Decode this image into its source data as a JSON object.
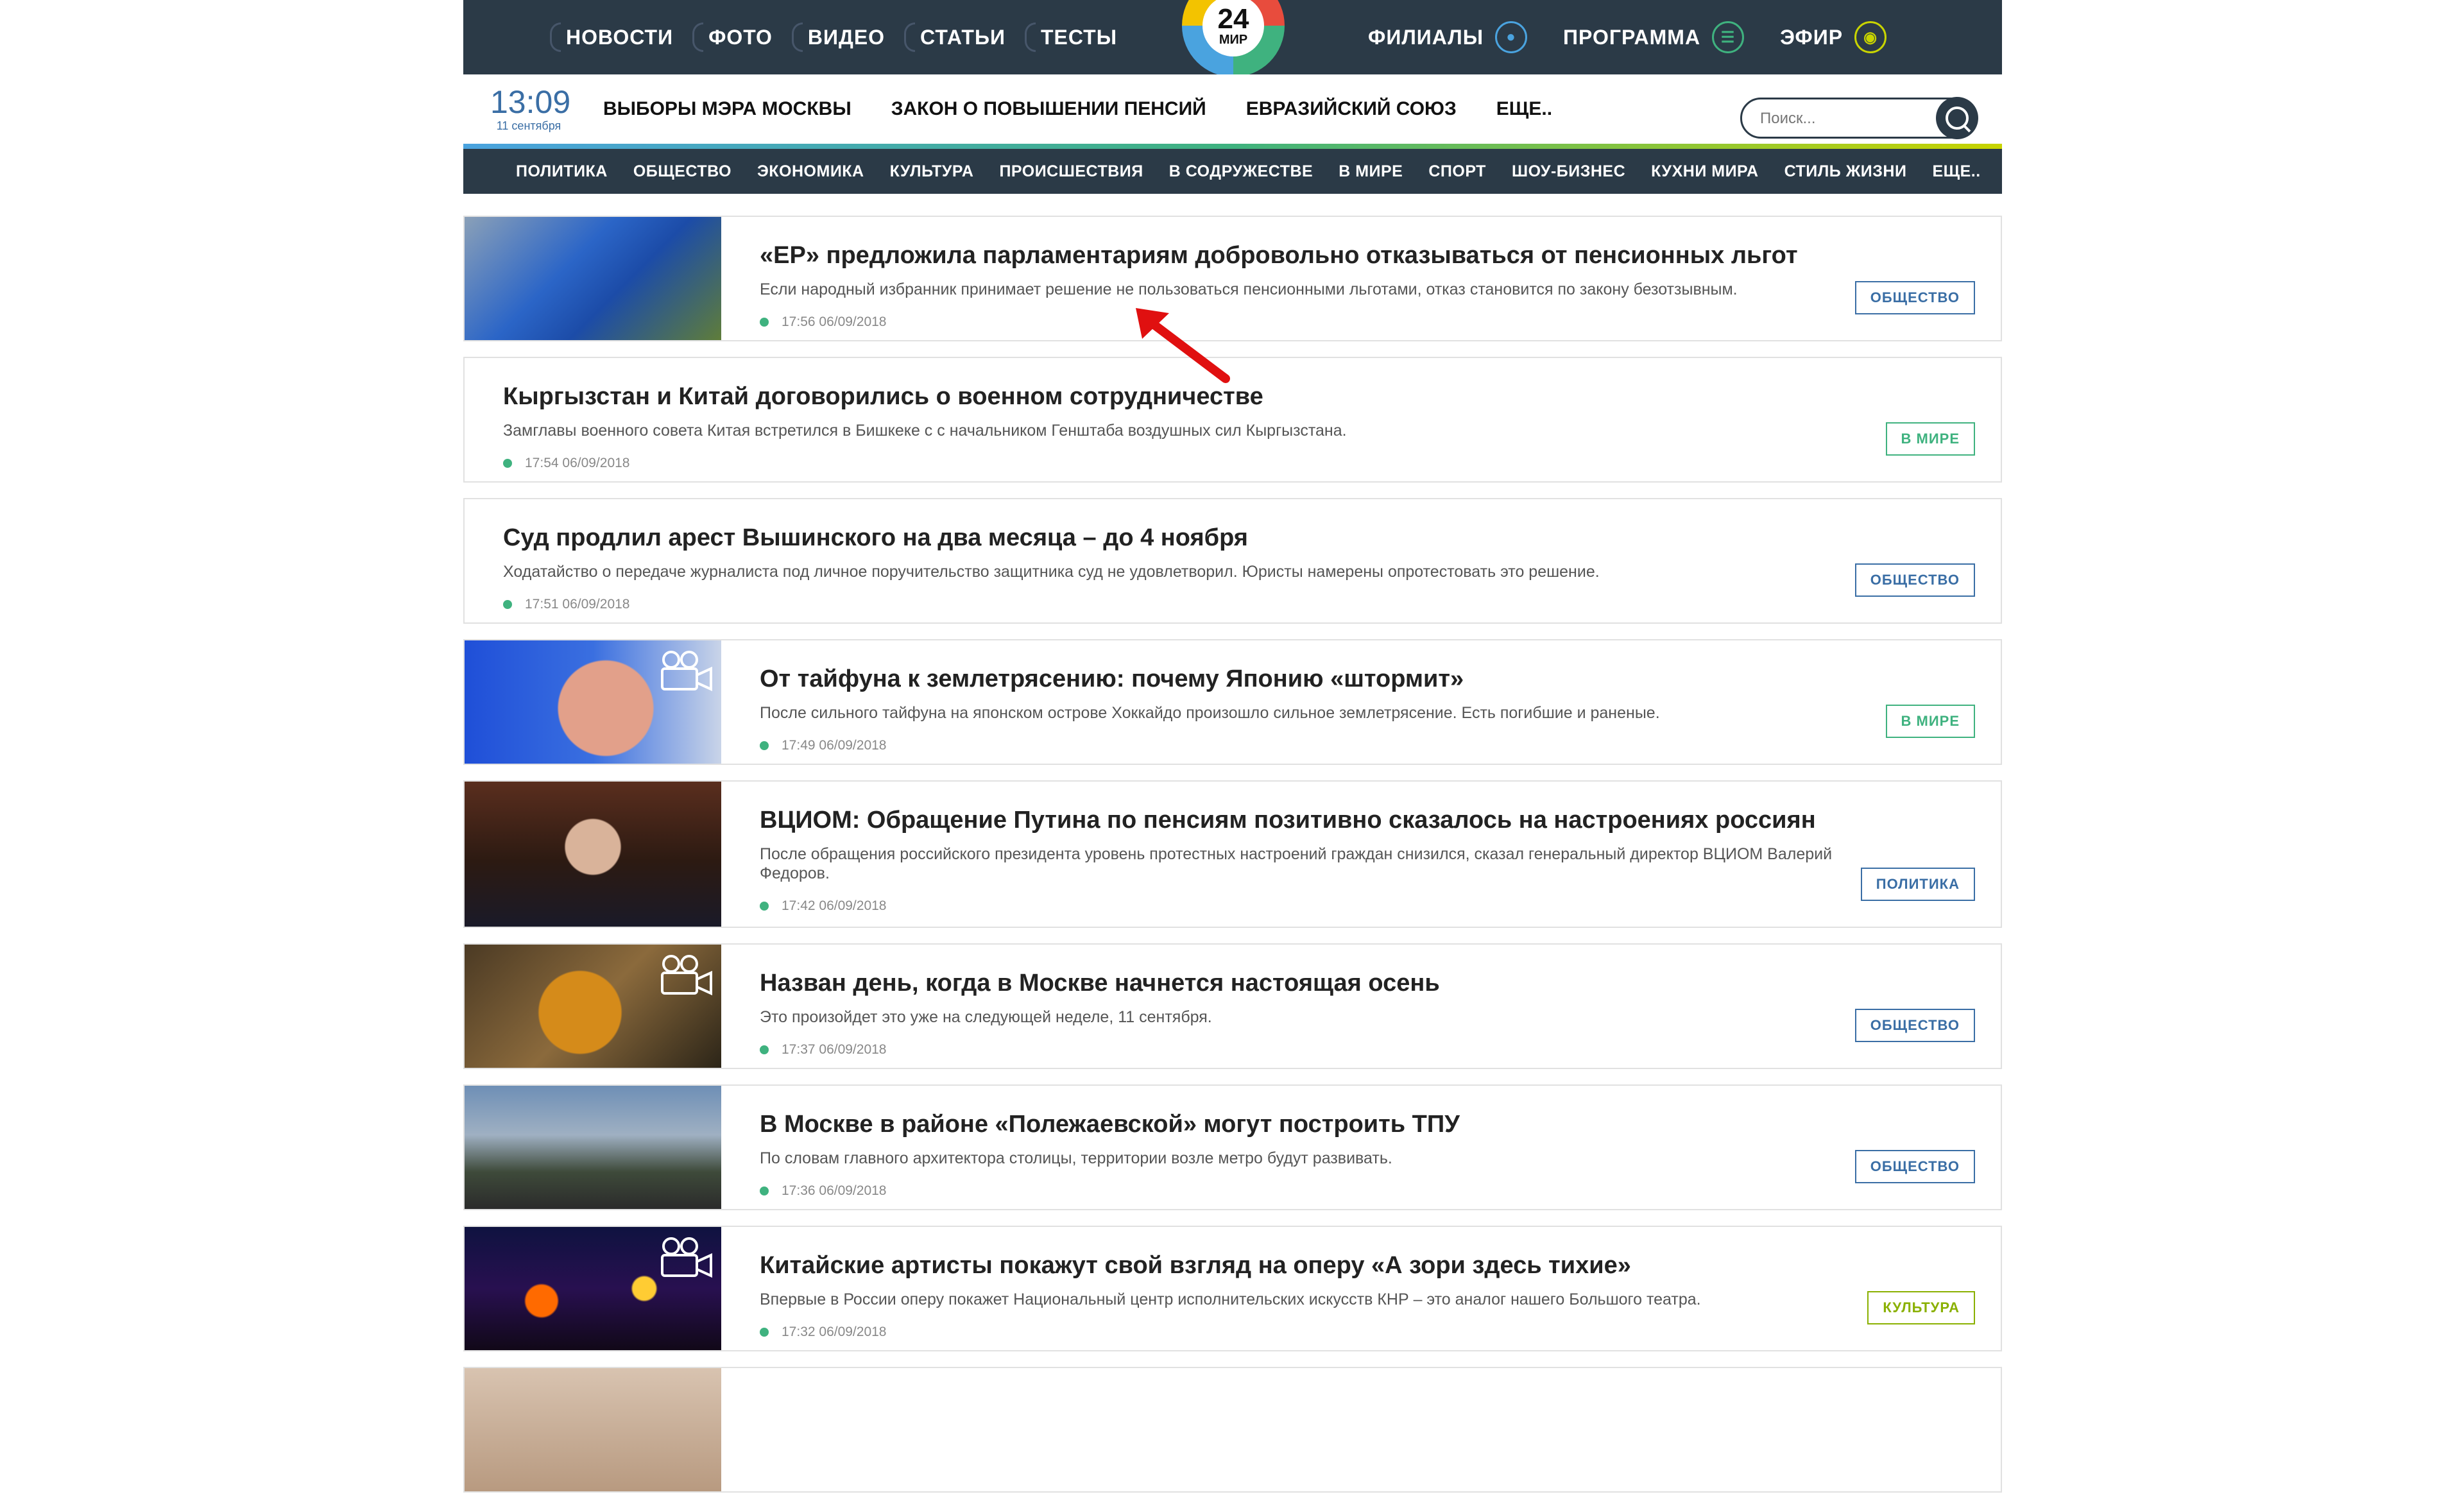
{
  "topnav": {
    "left": [
      "НОВОСТИ",
      "ФОТО",
      "ВИДЕО",
      "СТАТЬИ",
      "ТЕСТЫ"
    ],
    "logo_number": "24",
    "logo_word": "МИР",
    "right": [
      {
        "label": "ФИЛИАЛЫ",
        "icon": "location-pin-icon"
      },
      {
        "label": "ПРОГРАММА",
        "icon": "schedule-icon"
      },
      {
        "label": "ЭФИР",
        "icon": "live-broadcast-icon"
      }
    ]
  },
  "clock": {
    "time": "13:09",
    "date": "11 сентября"
  },
  "hot_links": [
    "ВЫБОРЫ МЭРА МОСКВЫ",
    "ЗАКОН О ПОВЫШЕНИИ ПЕНСИЙ",
    "ЕВРАЗИЙСКИЙ СОЮЗ",
    "ЕЩЕ.."
  ],
  "search": {
    "placeholder": "Поиск..."
  },
  "categories": [
    "ПОЛИТИКА",
    "ОБЩЕСТВО",
    "ЭКОНОМИКА",
    "КУЛЬТУРА",
    "ПРОИСШЕСТВИЯ",
    "В СОДРУЖЕСТВЕ",
    "В МИРЕ",
    "СПОРТ",
    "ШОУ-БИЗНЕС",
    "КУХНИ МИРА",
    "СТИЛЬ ЖИЗНИ",
    "ЕЩЕ.."
  ],
  "news": [
    {
      "title": "«ЕР» предложила парламентариям добровольно отказываться от пенсионных льгот",
      "desc": "Если народный избранник принимает решение не пользоваться пенсионными льготами, отказ становится по закону безотзывным.",
      "time": "17:56 06/09/2018",
      "tag": "ОБЩЕСТВО"
    },
    {
      "title": "Кыргызстан и Китай договорились о военном сотрудничестве",
      "desc": "Замглавы военного совета Китая встретился в Бишкеке с с начальником Генштаба воздушных сил Кыргызстана.",
      "time": "17:54 06/09/2018",
      "tag": "В МИРЕ"
    },
    {
      "title": "Суд продлил арест Вышинского на два месяца – до 4 ноября",
      "desc": "Ходатайство о передаче журналиста под личное поручительство защитника суд не удовлетворил. Юристы намерены опротестовать это решение.",
      "time": "17:51 06/09/2018",
      "tag": "ОБЩЕСТВО"
    },
    {
      "title": "От тайфуна к землетрясению: почему Японию «штормит»",
      "desc": "После сильного тайфуна на японском острове Хоккайдо произошло сильное землетрясение. Есть погибшие и раненые.",
      "time": "17:49 06/09/2018",
      "tag": "В МИРЕ"
    },
    {
      "title": "ВЦИОМ: Обращение Путина по пенсиям позитивно сказалось на настроениях россиян",
      "desc": "После обращения российского президента уровень протестных настроений граждан снизился, сказал генеральный директор ВЦИОМ Валерий Федоров.",
      "time": "17:42 06/09/2018",
      "tag": "ПОЛИТИКА"
    },
    {
      "title": "Назван день, когда в Москве начнется настоящая осень",
      "desc": "Это произойдет это уже на следующей неделе, 11 сентября.",
      "time": "17:37 06/09/2018",
      "tag": "ОБЩЕСТВО"
    },
    {
      "title": "В Москве в районе «Полежаевской» могут построить ТПУ",
      "desc": "По словам главного архитектора столицы, территории возле метро будут развивать.",
      "time": "17:36 06/09/2018",
      "tag": "ОБЩЕСТВО"
    },
    {
      "title": "Китайские артисты покажут свой взгляд на оперу «А зори здесь тихие»",
      "desc": "Впервые в России оперу покажет Национальный центр исполнительских искусств КНР – это аналог нашего Большого театра.",
      "time": "17:32 06/09/2018",
      "tag": "КУЛЬТУРА"
    }
  ],
  "colors": {
    "nav_bg": "#2b3a47",
    "accent_blue": "#3a6ea5",
    "accent_green": "#3fb27f",
    "accent_olive": "#8ab000",
    "annotation_arrow": "#e01010"
  }
}
